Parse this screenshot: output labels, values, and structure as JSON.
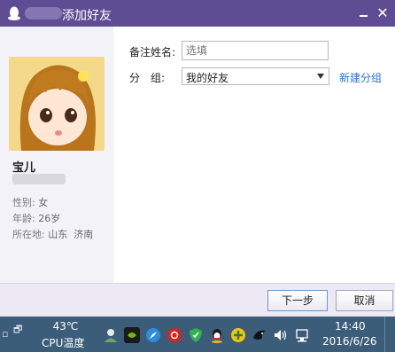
{
  "window": {
    "title": "添加好友",
    "colors": {
      "titlebar": "#5e4d93",
      "link": "#2b76d2"
    }
  },
  "profile": {
    "name": "宝儿",
    "gender_label": "性别:",
    "gender": "女",
    "age_label": "年龄:",
    "age": "26岁",
    "location_label": "所在地:",
    "location": "山东  济南"
  },
  "form": {
    "remark_label": "备注姓名:",
    "remark_placeholder": "选填",
    "group_label": "分　组:",
    "group_value": "我的好友",
    "new_group_link": "新建分组"
  },
  "buttons": {
    "next": "下一步",
    "cancel": "取消"
  },
  "taskbar": {
    "temperature": "43℃",
    "cpu_label": "CPU温度",
    "time": "14:40",
    "date": "2016/6/26",
    "tray_icons": [
      "user-icon",
      "nvidia-icon",
      "browser-icon",
      "netease-music-icon",
      "security-shield-icon",
      "qq-icon",
      "plus-icon",
      "bird-icon",
      "volume-icon",
      "network-icon"
    ]
  }
}
